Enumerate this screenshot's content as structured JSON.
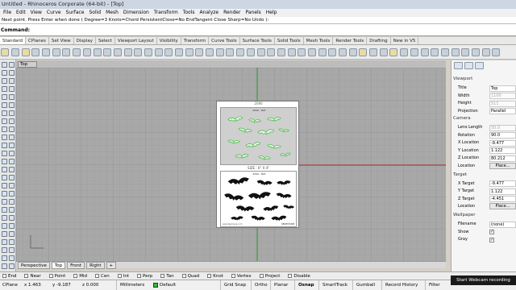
{
  "title": "Untitled - Rhinoceros Corporate (64-bit) - [Top]",
  "menu": [
    "File",
    "Edit",
    "View",
    "Curve",
    "Surface",
    "Solid",
    "Mesh",
    "Dimension",
    "Transform",
    "Tools",
    "Analyze",
    "Render",
    "Panels",
    "Help"
  ],
  "command_history": "Next point. Press Enter when done ( Degree=3  Knots=Chord  PersistentClose=No  EndTangent  Close  Sharp=No  Undo ):",
  "command_prompt": "Command:",
  "toolbar_tabs": [
    "Standard",
    "CPlanes",
    "Set View",
    "Display",
    "Select",
    "Viewport Layout",
    "Visibility",
    "Transform",
    "Curve Tools",
    "Surface Tools",
    "Solid Tools",
    "Mesh Tools",
    "Render Tools",
    "Drafting",
    "New in V5"
  ],
  "viewport": {
    "title": "Top",
    "tabs": [
      "Perspective",
      "Top",
      "Front",
      "Right"
    ],
    "add_tab": "+"
  },
  "paper": {
    "top_caption": "2090",
    "top_subtitle": "2090 - BAT",
    "size_label": "SIZE : 6\" X 4\"",
    "bottom_subtitle": "2090 - BAT",
    "footer_left": "www.tasmania.com",
    "footer_brand": "laserload"
  },
  "panel": {
    "tab_icons": [
      "properties-icon",
      "layers-icon",
      "display-icon"
    ],
    "viewport_section": "Viewport",
    "viewport_rows": [
      {
        "k": "Title",
        "v": "Top",
        "gray": false
      },
      {
        "k": "Width",
        "v": "1100",
        "gray": true
      },
      {
        "k": "Height",
        "v": "511",
        "gray": true
      },
      {
        "k": "Projection",
        "v": "Parallel",
        "gray": false
      }
    ],
    "camera_section": "Camera",
    "camera_rows": [
      {
        "k": "Lens Length",
        "v": "50.0",
        "gray": true
      },
      {
        "k": "Rotation",
        "v": "90.0",
        "gray": false
      },
      {
        "k": "X Location",
        "v": "-9.477",
        "gray": false
      },
      {
        "k": "Y Location",
        "v": "1.122",
        "gray": false
      },
      {
        "k": "Z Location",
        "v": "80.212",
        "gray": false
      }
    ],
    "camera_location_label": "Location",
    "place_button": "Place...",
    "target_section": "Target",
    "target_rows": [
      {
        "k": "X Target",
        "v": "-9.477",
        "gray": false
      },
      {
        "k": "Y Target",
        "v": "1.122",
        "gray": false
      },
      {
        "k": "Z Target",
        "v": "-4.451",
        "gray": false
      }
    ],
    "target_location_label": "Location",
    "wallpaper_section": "Wallpaper",
    "wallpaper_rows": [
      {
        "k": "Filename",
        "v": "(none)"
      },
      {
        "k": "Show",
        "v": "✓"
      },
      {
        "k": "Gray",
        "v": "✓"
      }
    ]
  },
  "osnaps": [
    "End",
    "Near",
    "Point",
    "Mid",
    "Cen",
    "Int",
    "Perp",
    "Tan",
    "Quad",
    "Knot",
    "Vertex",
    "Project",
    "Disable"
  ],
  "status": {
    "cplane": "CPlane",
    "x": "x 1.463",
    "y": "y -9.187",
    "z": "z 0.000",
    "units": "Millimeters",
    "layer": "Default",
    "layer_color": "#33bb33",
    "panes": [
      "Grid Snap",
      "Ortho",
      "Planar",
      "Osnap",
      "SmartTrack",
      "Gumball",
      "Record History",
      "Filter"
    ],
    "active_pane": "Osnap"
  },
  "toast": "Start Webcam recording"
}
